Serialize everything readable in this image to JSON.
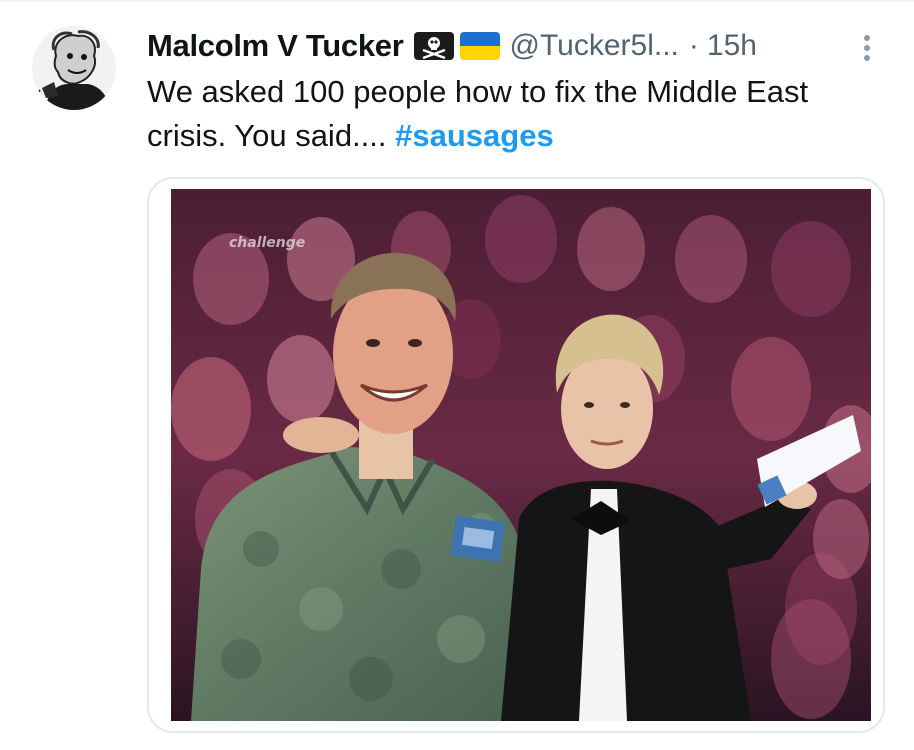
{
  "tweet": {
    "author": {
      "display_name": "Malcolm V Tucker",
      "handle": "@Tucker5l...",
      "avatar_icon": "caricature-avatar",
      "name_emojis": [
        "pirate-flag-emoji",
        "ukraine-flag-emoji"
      ]
    },
    "separator": "·",
    "timestamp": "15h",
    "text_plain": "We asked 100 people how to fix the Middle East crisis. You said.... ",
    "hashtag": "#sausages",
    "more_icon": "more-vertical-icon",
    "media": {
      "type": "photo",
      "watermark_text": "challenge"
    }
  },
  "colors": {
    "text_primary": "#0f1419",
    "text_secondary": "#536471",
    "link": "#1d9bf0",
    "card_border": "#e3e8eb"
  }
}
